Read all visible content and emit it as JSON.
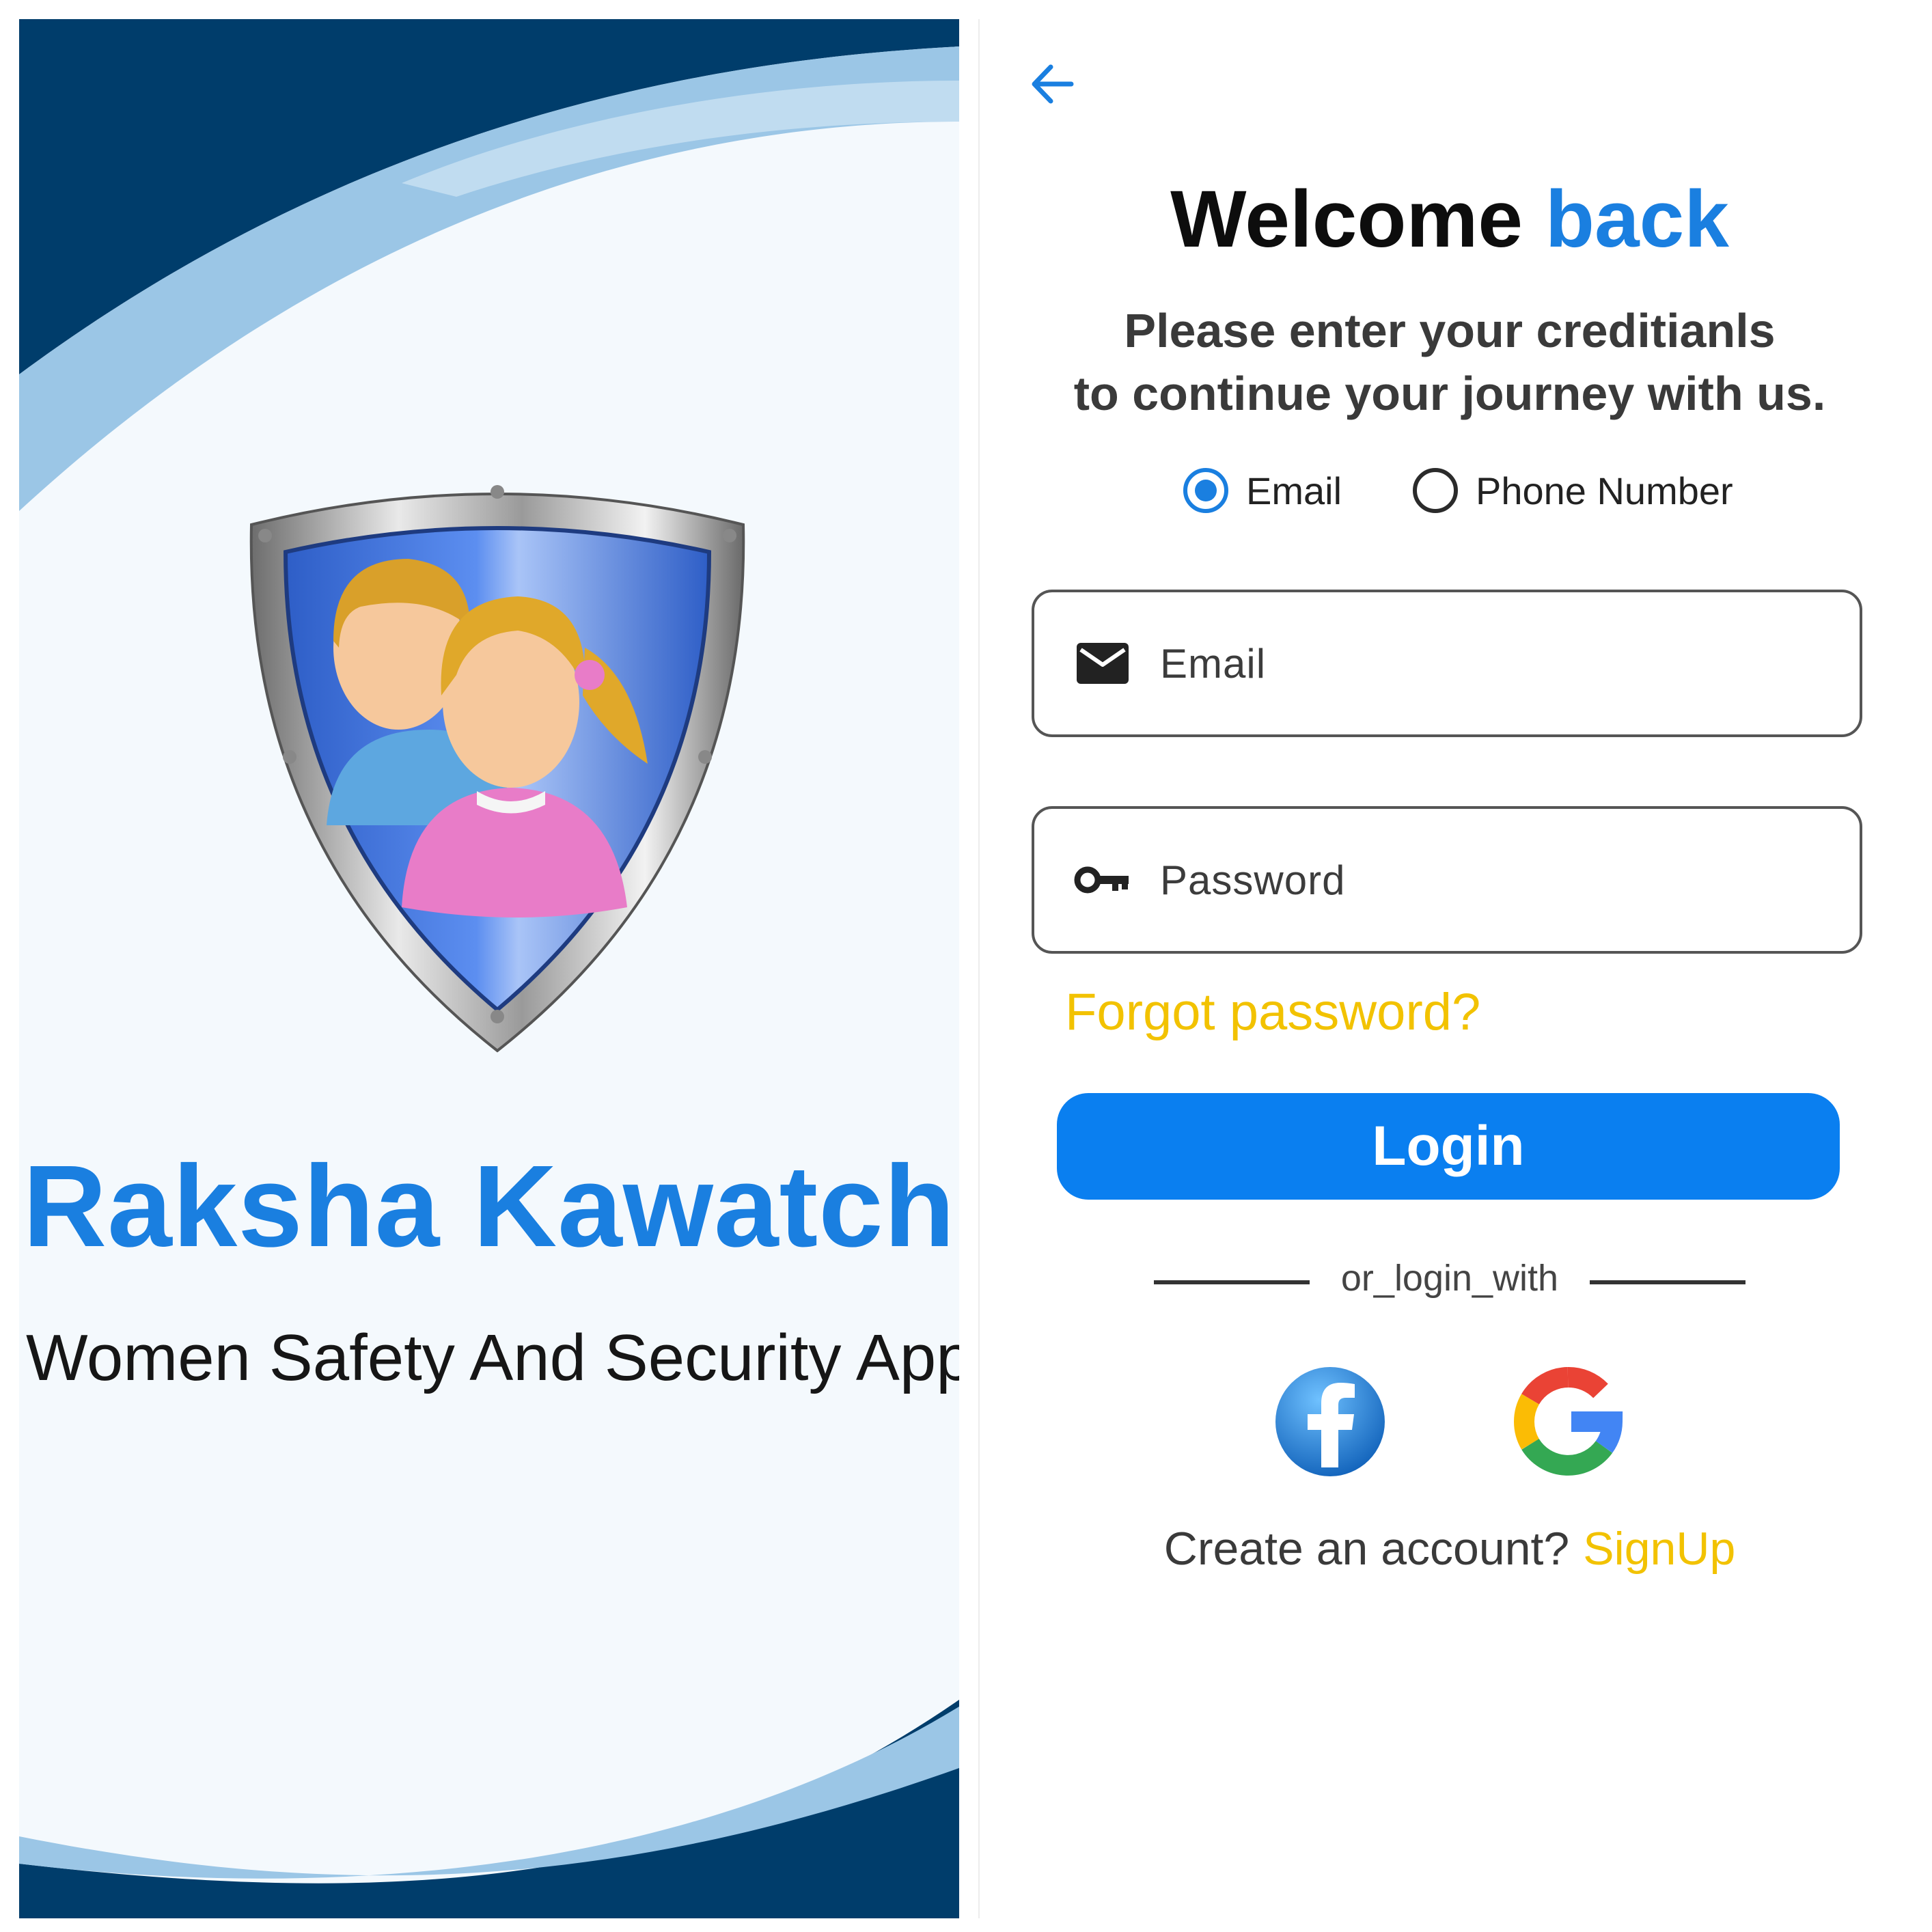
{
  "splash": {
    "app_title": "Raksha Kawatch",
    "tagline": "Women Safety And Security App",
    "logo_icon": "shield-women-icon",
    "colors": {
      "dark_navy": "#003d6b",
      "light_blue": "#9bc6e6",
      "title_blue": "#1a7fe0"
    }
  },
  "login": {
    "back_icon": "arrow-left-icon",
    "welcome": {
      "prefix": "Welcome",
      "accent": "back"
    },
    "subtitle_line1": "Please enter your creditianls",
    "subtitle_line2": "to continue your journey with us.",
    "radio": {
      "email_label": "Email",
      "phone_label": "Phone Number",
      "selected": "Email"
    },
    "email_field": {
      "placeholder": "Email",
      "icon": "envelope-icon",
      "value": ""
    },
    "password_field": {
      "placeholder": "Password",
      "icon": "key-icon",
      "value": ""
    },
    "forgot_password": "Forgot password?",
    "login_button": "Login",
    "divider_text": "or_login_with",
    "social": {
      "facebook_icon": "facebook-icon",
      "google_icon": "google-icon"
    },
    "account_question": "Create an account?",
    "signup_link": "SignUp",
    "colors": {
      "primary": "#0a7ff0",
      "accent_yellow": "#f2c200"
    }
  }
}
